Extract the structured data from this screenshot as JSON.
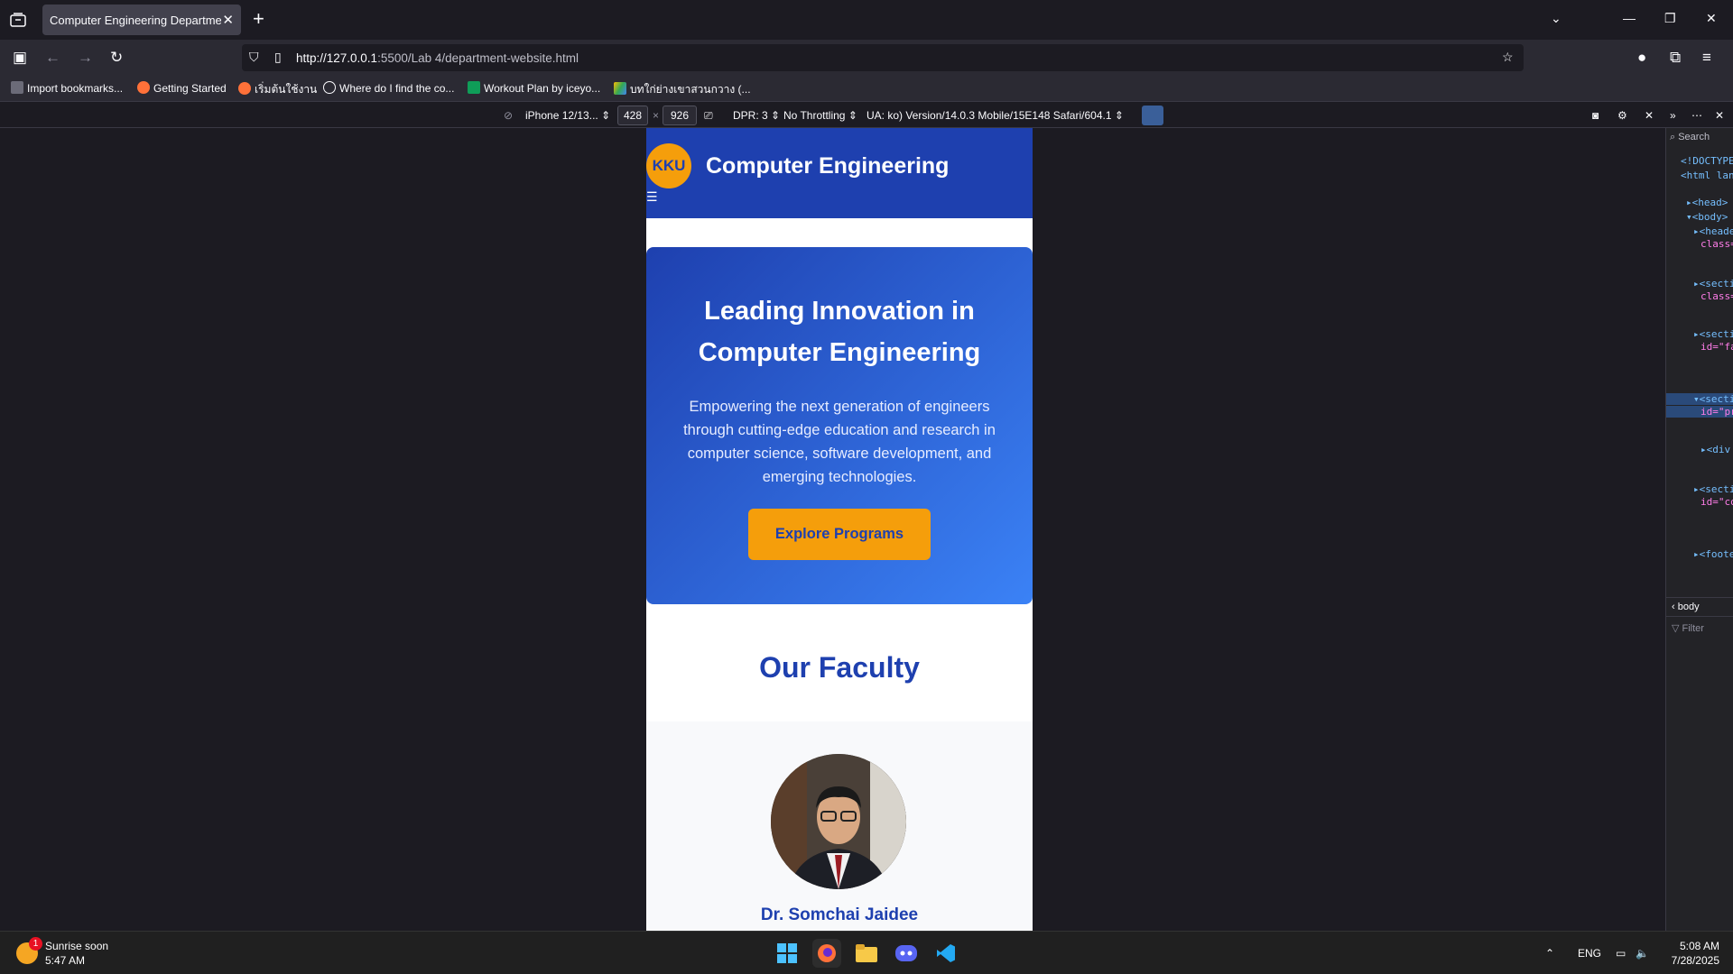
{
  "browser": {
    "tab_title": "Computer Engineering Department",
    "tab_close": "✕",
    "new_tab": "+",
    "url_host": "http://127.0.0.1",
    "url_rest": ":5500/Lab 4/department-website.html",
    "bookmarks": [
      {
        "label": "Import bookmarks...",
        "icon": "import-icon"
      },
      {
        "label": "Getting Started",
        "icon": "firefox-icon"
      },
      {
        "label": "เริ่มต้นใช้งาน",
        "icon": "firefox-icon"
      },
      {
        "label": "Where do I find the co...",
        "icon": "globe-icon"
      },
      {
        "label": "Workout Plan by iceyo...",
        "icon": "sheets-icon"
      },
      {
        "label": "บทใก่ย่างเขาสวนกวาง (...",
        "icon": "drive-icon"
      }
    ]
  },
  "devtools_toolbar": {
    "device": "iPhone 12/13...",
    "width": "428",
    "times": "×",
    "height": "926",
    "dpr": "DPR: 3",
    "throttle": "No Throttling",
    "ua": "UA: ko) Version/14.0.3 Mobile/15E148 Safari/604.1"
  },
  "site": {
    "logo": "KKU",
    "title": "Computer Engineering",
    "menu_icon": "☰",
    "hero_title": "Leading Innovation in Computer Engineering",
    "hero_text": "Empowering the next generation of engineers through cutting-edge education and research in computer science, software development, and emerging technologies.",
    "hero_button": "Explore Programs",
    "faculty_heading": "Our Faculty",
    "faculty_name": "Dr. Somchai Jaidee"
  },
  "devtools_panel": {
    "search": "Search",
    "breadcrumb": "body",
    "filter": "Filter"
  },
  "taskbar": {
    "weather_title": "Sunrise soon",
    "weather_time": "5:47 AM",
    "notif_count": "1",
    "language": "ENG",
    "time": "5:08 AM",
    "date": "7/28/2025"
  }
}
